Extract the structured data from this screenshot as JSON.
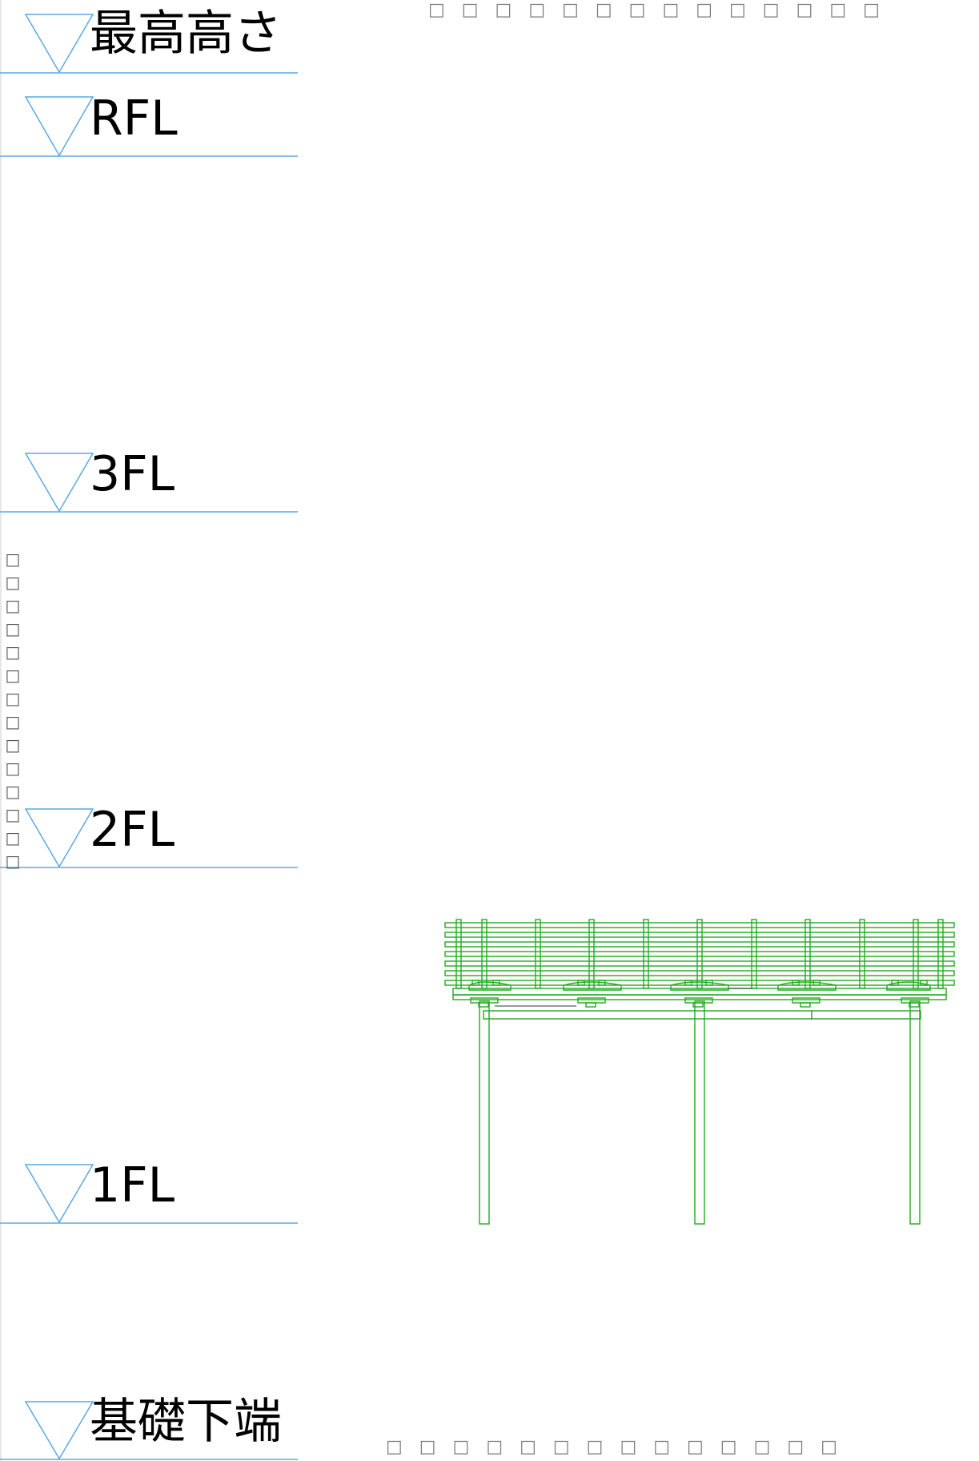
{
  "levels": [
    {
      "id": "max-height",
      "label": "最高高さ"
    },
    {
      "id": "rfl",
      "label": "RFL"
    },
    {
      "id": "3fl",
      "label": "3FL"
    },
    {
      "id": "2fl",
      "label": "2FL"
    },
    {
      "id": "1fl",
      "label": "1FL"
    },
    {
      "id": "foundation-bottom",
      "label": "基礎下端"
    }
  ],
  "top_caption": "□ □ □ □ □ □ □ □ □ □ □ □ □ □",
  "bottom_caption": "□ □ □ □ □ □ □ □ □ □ □ □ □ □",
  "left_vertical_caption": [
    "□",
    "□",
    "□",
    "□",
    "□",
    "□",
    "□",
    "□",
    "□",
    "□",
    "□",
    "□",
    "□",
    "□"
  ],
  "colors": {
    "level_line": "#5aa9e6",
    "structure": "#22aa22",
    "detail_line": "#333333"
  }
}
